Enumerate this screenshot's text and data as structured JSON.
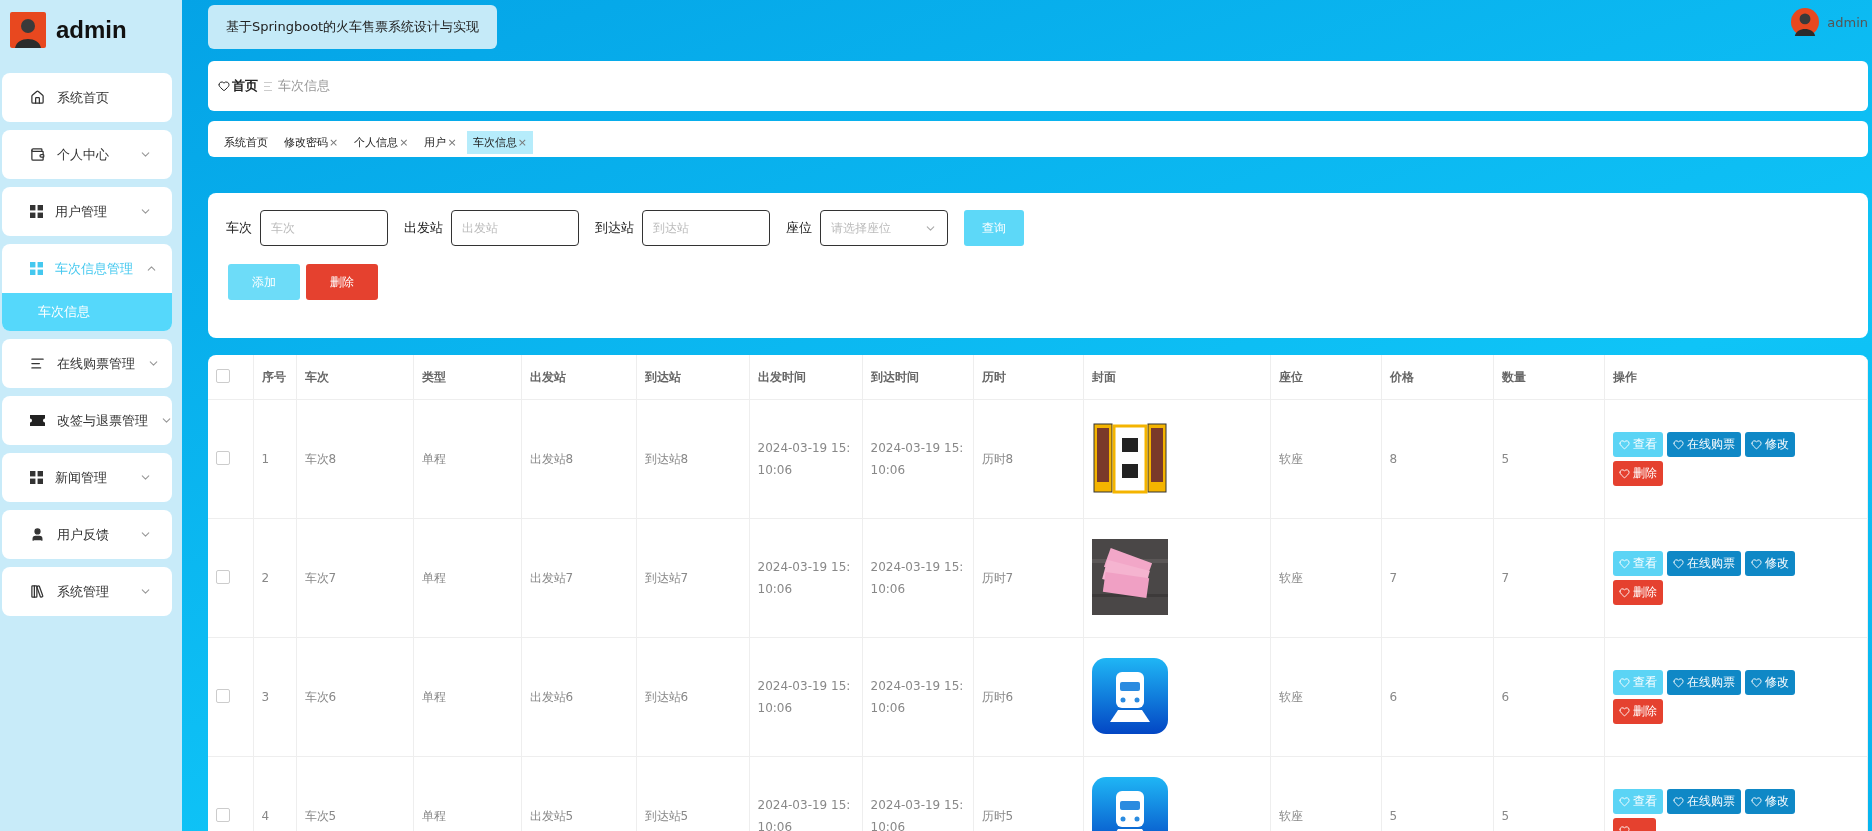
{
  "sidebar": {
    "user": "admin",
    "items": [
      {
        "label": "系统首页",
        "kind": "link",
        "expanded": false
      },
      {
        "label": "个人中心",
        "kind": "group",
        "expanded": false
      },
      {
        "label": "用户管理",
        "kind": "group",
        "expanded": false
      },
      {
        "label": "车次信息管理",
        "kind": "group",
        "expanded": true,
        "children": [
          {
            "label": "车次信息",
            "selected": true
          }
        ]
      },
      {
        "label": "在线购票管理",
        "kind": "group",
        "expanded": false
      },
      {
        "label": "改签与退票管理",
        "kind": "group",
        "expanded": false
      },
      {
        "label": "新闻管理",
        "kind": "group",
        "expanded": false
      },
      {
        "label": "用户反馈",
        "kind": "group",
        "expanded": false
      },
      {
        "label": "系统管理",
        "kind": "group",
        "expanded": false
      }
    ]
  },
  "header": {
    "title": "基于Springboot的火车售票系统设计与实现",
    "user": "admin"
  },
  "breadcrumb": {
    "home": "首页",
    "current": "车次信息"
  },
  "tags": [
    {
      "label": "系统首页",
      "selected": false
    },
    {
      "label": "修改密码",
      "close": "×",
      "selected": false
    },
    {
      "label": "个人信息",
      "close": "×",
      "selected": false
    },
    {
      "label": "用户",
      "close": "×",
      "selected": false
    },
    {
      "label": "车次信息",
      "close": "×",
      "selected": true
    }
  ],
  "search": {
    "fields": [
      {
        "label": "车次",
        "kind": "input",
        "placeholder": "车次"
      },
      {
        "label": "出发站",
        "kind": "input",
        "placeholder": "出发站"
      },
      {
        "label": "到达站",
        "kind": "input",
        "placeholder": "到达站"
      },
      {
        "label": "座位",
        "kind": "select",
        "placeholder": "请选择座位"
      }
    ],
    "query": "查询",
    "add": "添加",
    "delete": "删除"
  },
  "table": {
    "header_checked": false,
    "columns": [
      "序号",
      "车次",
      "类型",
      "出发站",
      "到达站",
      "出发时间",
      "到达时间",
      "历时",
      "封面",
      "座位",
      "价格",
      "数量",
      "操作"
    ],
    "rows": [
      {
        "checked": false,
        "cells": [
          "1",
          "车次8",
          "单程",
          "出发站8",
          "到达站8",
          "2024-03-19 15:10:06",
          "2024-03-19 15:10:06",
          "历时8",
          {
            "kind": "picture"
          },
          "软座",
          "8",
          "5"
        ],
        "actions": [
          {
            "label": "查看",
            "kind": "view"
          },
          {
            "label": "在线购票",
            "kind": "buy"
          },
          {
            "label": "修改",
            "kind": "edit"
          },
          {
            "label": "删除",
            "kind": "delete"
          }
        ]
      },
      {
        "checked": false,
        "cells": [
          "2",
          "车次7",
          "单程",
          "出发站7",
          "到达站7",
          "2024-03-19 15:10:06",
          "2024-03-19 15:10:06",
          "历时7",
          {
            "kind": "picture"
          },
          "软座",
          "7",
          "7"
        ],
        "actions": [
          {
            "label": "查看",
            "kind": "view"
          },
          {
            "label": "在线购票",
            "kind": "buy"
          },
          {
            "label": "修改",
            "kind": "edit"
          },
          {
            "label": "删除",
            "kind": "delete"
          }
        ]
      },
      {
        "checked": false,
        "cells": [
          "3",
          "车次6",
          "单程",
          "出发站6",
          "到达站6",
          "2024-03-19 15:10:06",
          "2024-03-19 15:10:06",
          "历时6",
          {
            "kind": "picture"
          },
          "软座",
          "6",
          "6"
        ],
        "actions": [
          {
            "label": "查看",
            "kind": "view"
          },
          {
            "label": "在线购票",
            "kind": "buy"
          },
          {
            "label": "修改",
            "kind": "edit"
          },
          {
            "label": "删除",
            "kind": "delete"
          }
        ]
      },
      {
        "checked": false,
        "cells": [
          "4",
          "车次5",
          "单程",
          "出发站5",
          "到达站5",
          "2024-03-19 15:10:06",
          "2024-03-19 15:10:06",
          "历时5",
          {
            "kind": "picture"
          },
          "软座",
          "5",
          "5"
        ],
        "actions": [
          {
            "label": "查看",
            "kind": "view"
          },
          {
            "label": "在线购票",
            "kind": "buy"
          },
          {
            "label": "修改",
            "kind": "edit"
          },
          {
            "kind": "delete"
          }
        ]
      }
    ]
  }
}
